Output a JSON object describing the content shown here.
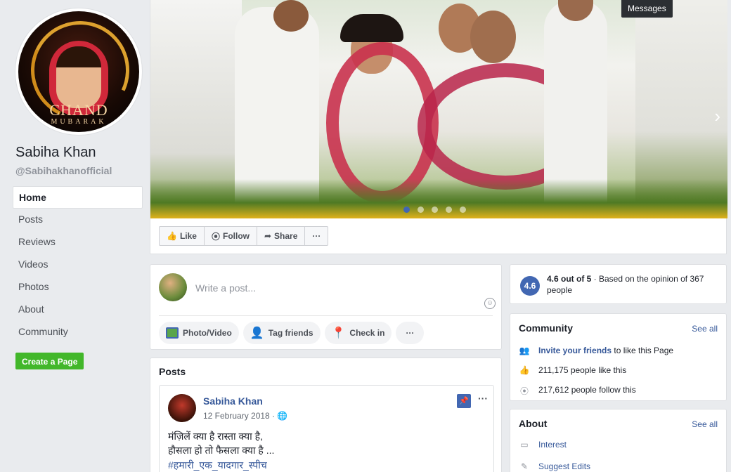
{
  "page": {
    "name": "Sabiha Khan",
    "handle": "@Sabihakhanofficial",
    "profile_caption_1": "CHAND",
    "profile_caption_2": "MUBARAK"
  },
  "nav": {
    "items": [
      "Home",
      "Posts",
      "Reviews",
      "Videos",
      "Photos",
      "About",
      "Community"
    ],
    "active": "Home",
    "create_page": "Create a Page"
  },
  "header": {
    "messages": "Messages"
  },
  "cover": {
    "slides": 5,
    "current_slide": 1
  },
  "actions": {
    "like": "Like",
    "follow": "Follow",
    "share": "Share",
    "more": "···"
  },
  "composer": {
    "placeholder": "Write a post...",
    "photo_video": "Photo/Video",
    "tag_friends": "Tag friends",
    "check_in": "Check in",
    "more": "···"
  },
  "posts": {
    "title": "Posts",
    "items": [
      {
        "author": "Sabiha Khan",
        "date": "12 February 2018 ·",
        "line1": "मंज़िलें क्या है रास्ता क्या है,",
        "line2": "हौसला हो तो फैसला क्या है ...",
        "hashtag": "#हमारी_एक_यादगार_स्पीच"
      }
    ]
  },
  "rating": {
    "score": "4.6",
    "summary": "4.6 out of 5",
    "detail": " · Based on the opinion of 367 people"
  },
  "community": {
    "title": "Community",
    "see_all": "See all",
    "invite_link": "Invite your friends",
    "invite_rest": " to like this Page",
    "likes": "211,175 people like this",
    "follows": "217,612 people follow this"
  },
  "about": {
    "title": "About",
    "see_all": "See all",
    "interest": "Interest",
    "suggest_edits": "Suggest Edits"
  },
  "colors": {
    "brand": "#4267b2",
    "link": "#365899",
    "create_green": "#42b72a",
    "background": "#e9ebee"
  }
}
